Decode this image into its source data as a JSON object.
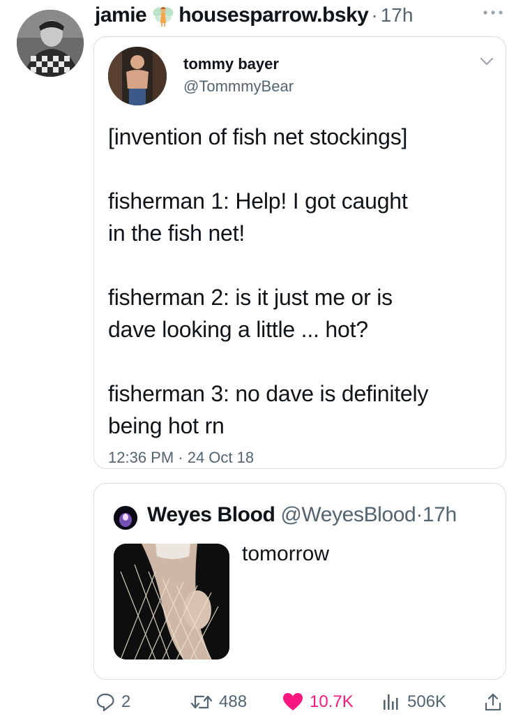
{
  "post": {
    "display_name": "jamie",
    "handle": "housesparrow.bsky",
    "separator": "·",
    "time": "17h",
    "avatar_icon": "profile-photo",
    "name_emoji_icon": "fairy-icon",
    "more_icon": "more-dots-icon"
  },
  "screenshot_card": {
    "author_name": "tommy bayer",
    "author_handle": "@TommmyBear",
    "chevron_icon": "chevron-down-icon",
    "body": {
      "line1": "[invention of fish net stockings]",
      "line2": "fisherman 1: Help! I got caught",
      "line3": "in the fish net!",
      "line4": "fisherman 2:  is it just me or is",
      "line5": "dave looking a little ... hot?",
      "line6": "fisherman 3: no dave is definitely",
      "line7": "being hot rn"
    },
    "timestamp": "12:36 PM · 24 Oct 18"
  },
  "quoted": {
    "author_name": "Weyes Blood",
    "author_handle": "@WeyesBlood",
    "separator": "·",
    "time": "17h",
    "text": "tomorrow",
    "media_icon": "fishnet-photo"
  },
  "actions": {
    "replies": "2",
    "reposts": "488",
    "likes": "10.7K",
    "views": "506K",
    "like_color": "#f91880",
    "icons": [
      "reply-icon",
      "repost-icon",
      "like-icon",
      "views-icon",
      "share-icon"
    ]
  }
}
